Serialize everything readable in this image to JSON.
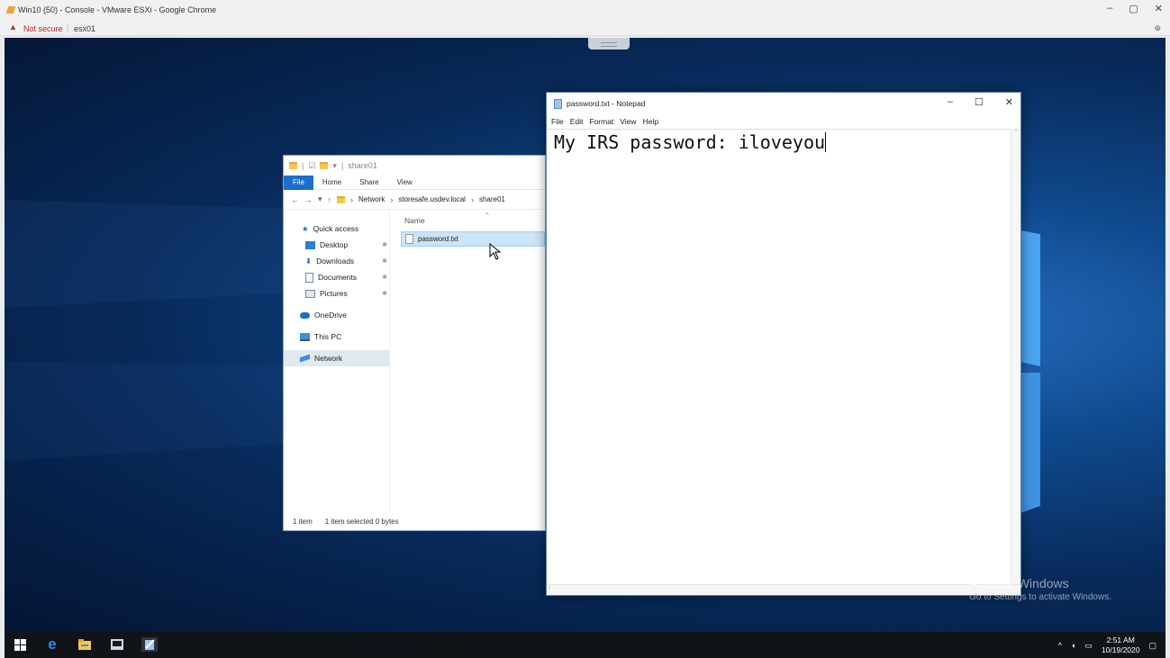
{
  "browser": {
    "tab_title": "Win10 (50) - Console - VMware ESXi - Google Chrome",
    "not_secure": "Not secure",
    "host": "esx01",
    "controls": [
      "–",
      "▢",
      "✕"
    ]
  },
  "explorer": {
    "qat_title": "share01",
    "ribbon_tabs": [
      "File",
      "Home",
      "Share",
      "View"
    ],
    "path": [
      "Network",
      "storesafe.usdev.local",
      "share01"
    ],
    "nav": {
      "quick_access": "Quick access",
      "desktop": "Desktop",
      "downloads": "Downloads",
      "documents": "Documents",
      "pictures": "Pictures",
      "onedrive": "OneDrive",
      "this_pc": "This PC",
      "network": "Network"
    },
    "column_name": "Name",
    "file_name": "password.txt",
    "status_items": "1 item",
    "status_selected": "1 item selected  0 bytes"
  },
  "notepad": {
    "title": "password.txt - Notepad",
    "menu": [
      "File",
      "Edit",
      "Format",
      "View",
      "Help"
    ],
    "content": "My IRS password: iloveyou"
  },
  "watermark": {
    "line1": "Activate Windows",
    "line2": "Go to Settings to activate Windows."
  },
  "taskbar": {
    "time": "2:51 AM",
    "date": "10/19/2020"
  }
}
